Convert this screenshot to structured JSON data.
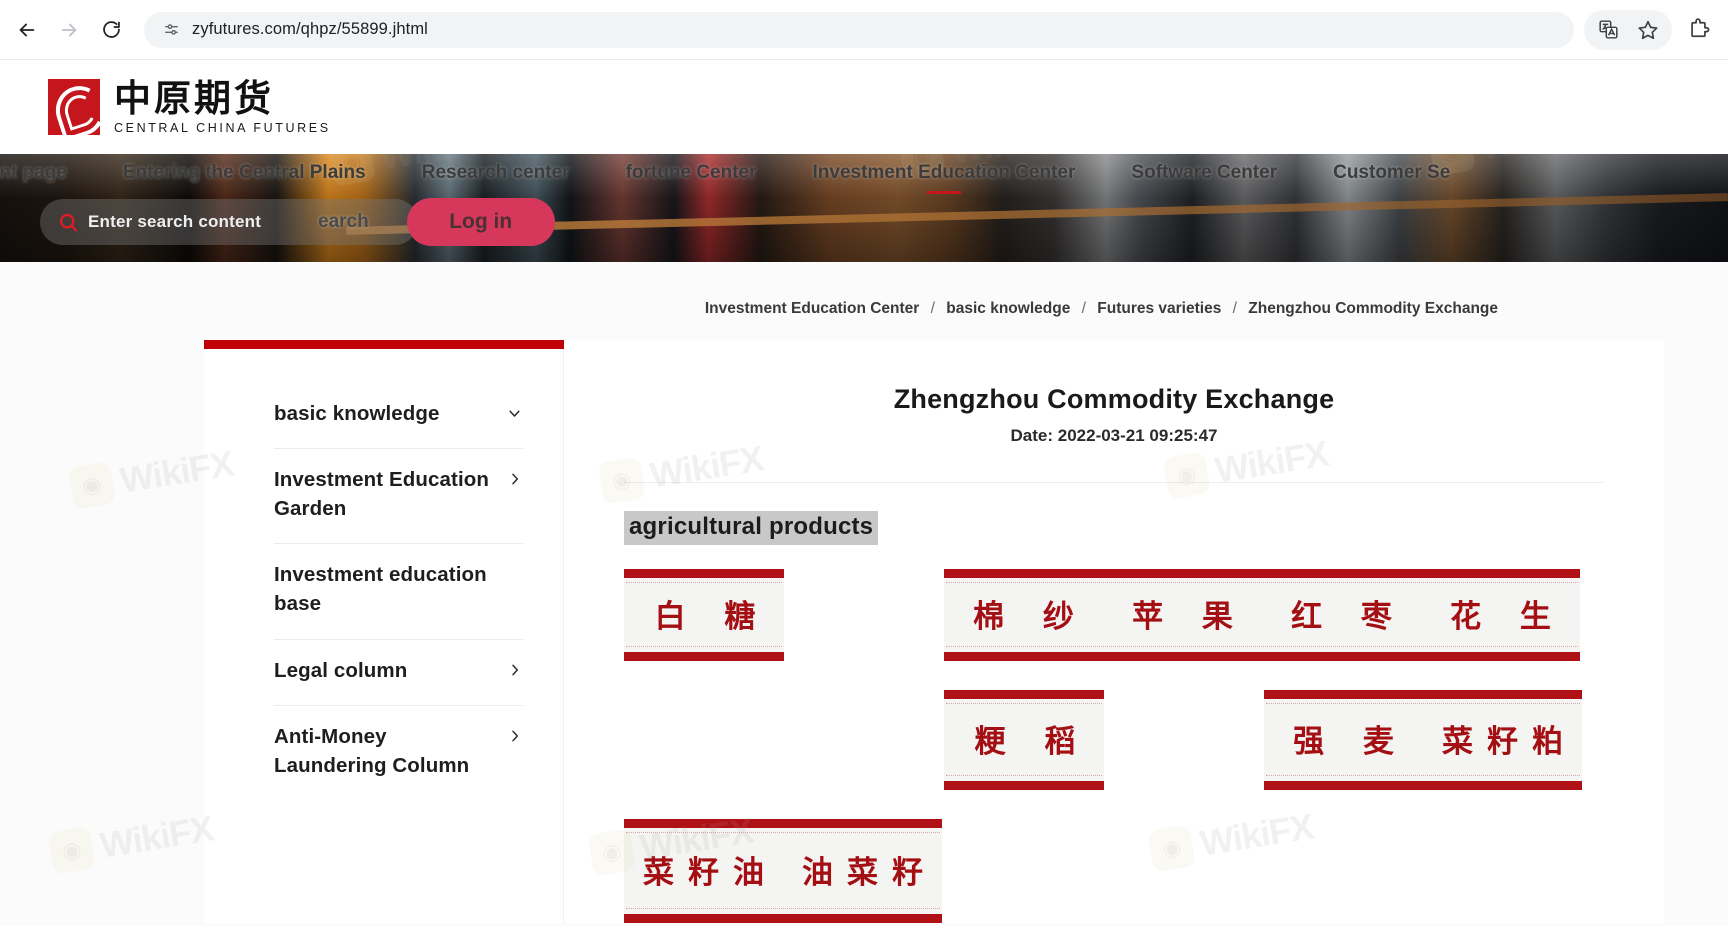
{
  "browser": {
    "url": "zyfutures.com/qhpz/55899.jhtml",
    "back_label": "Back",
    "forward_label": "Forward",
    "reload_label": "Reload",
    "site_info_label": "View site information",
    "translate_label": "Translate this page",
    "bookmark_label": "Bookmark this tab",
    "extensions_label": "Extensions"
  },
  "site": {
    "logo_cn": "中原期货",
    "logo_en": "CENTRAL CHINA FUTURES",
    "accent_red": "#c00007",
    "block_red": "#b01116",
    "brand_red": "#c4161c"
  },
  "nav": {
    "items": [
      {
        "label": "front page",
        "active": false
      },
      {
        "label": "Entering the Central Plains",
        "active": false
      },
      {
        "label": "Research center",
        "active": false
      },
      {
        "label": "fortune Center",
        "active": false
      },
      {
        "label": "Investment Education Center",
        "active": true
      },
      {
        "label": "Software Center",
        "active": false
      },
      {
        "label": "Customer Se",
        "active": false
      }
    ]
  },
  "search": {
    "placeholder": "Enter search content",
    "value": "",
    "button_label": "earch",
    "icon": "search-icon"
  },
  "login": {
    "label": "Log in"
  },
  "breadcrumb": {
    "items": [
      "Investment Education Center",
      "basic knowledge",
      "Futures varieties",
      "Zhengzhou Commodity Exchange"
    ],
    "separator": "/"
  },
  "sidebar": {
    "items": [
      {
        "label": "basic knowledge",
        "chevron": "chevron-down-icon"
      },
      {
        "label": "Investment Education Garden",
        "chevron": "chevron-right-icon"
      },
      {
        "label": "Investment education base",
        "chevron": "none"
      },
      {
        "label": "Legal column",
        "chevron": "chevron-right-icon"
      },
      {
        "label": "Anti-Money Laundering Column",
        "chevron": "chevron-right-icon"
      }
    ]
  },
  "article": {
    "title": "Zhengzhou Commodity Exchange",
    "date": "Date: 2022-03-21 09:25:47",
    "section_heading": "agricultural products",
    "commodity_rows": [
      {
        "id": "row-sugar",
        "blocks": [
          {
            "id": "sugar",
            "names": [
              "白 糖"
            ],
            "translation": "white sugar"
          }
        ],
        "wide": [
          {
            "id": "cotton-apple-date-peanut",
            "names": [
              "棉 纱",
              "苹 果",
              "红 枣",
              "花 生"
            ],
            "translation": "cotton yarn / apple / red date / peanut"
          }
        ]
      },
      {
        "id": "row-rice",
        "blocks": [
          {
            "id": "japonica-rice",
            "names": [
              "粳 稻"
            ],
            "translation": "japonica rice"
          }
        ],
        "wide": [
          {
            "id": "wheat-rapeseed-meal",
            "names": [
              "强 麦",
              "菜籽粕"
            ],
            "translation": "strong wheat / rapeseed meal"
          }
        ]
      },
      {
        "id": "row-oil",
        "blocks": [],
        "wide": [
          {
            "id": "rapeseed-oil-rapeseed",
            "names": [
              "菜籽油",
              "油菜籽"
            ],
            "translation": "rapeseed oil / rapeseed"
          }
        ]
      }
    ]
  },
  "watermark": {
    "text": "WikiFX"
  }
}
